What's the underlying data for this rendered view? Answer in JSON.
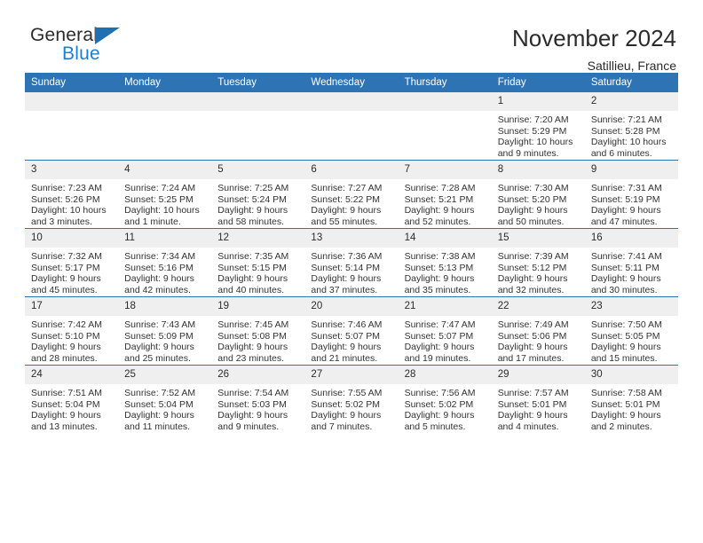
{
  "brand": {
    "name_part1": "General",
    "name_part2": "Blue",
    "triangle_color": "#1f6fb2",
    "blue_text_color": "#1b7fd4"
  },
  "header": {
    "month_title": "November 2024",
    "location": "Satillieu, France",
    "accent_color": "#2e74b5",
    "daynum_band_color": "#efefef"
  },
  "calendar": {
    "weekday_headers": [
      "Sunday",
      "Monday",
      "Tuesday",
      "Wednesday",
      "Thursday",
      "Friday",
      "Saturday"
    ],
    "labels": {
      "sunrise_prefix": "Sunrise:",
      "sunset_prefix": "Sunset:",
      "daylight_prefix": "Daylight:"
    },
    "weeks": [
      [
        {
          "day": "",
          "blank": true
        },
        {
          "day": "",
          "blank": true
        },
        {
          "day": "",
          "blank": true
        },
        {
          "day": "",
          "blank": true
        },
        {
          "day": "",
          "blank": true
        },
        {
          "day": "1",
          "sunrise": "Sunrise: 7:20 AM",
          "sunset": "Sunset: 5:29 PM",
          "daylight": "Daylight: 10 hours and 9 minutes."
        },
        {
          "day": "2",
          "sunrise": "Sunrise: 7:21 AM",
          "sunset": "Sunset: 5:28 PM",
          "daylight": "Daylight: 10 hours and 6 minutes."
        }
      ],
      [
        {
          "day": "3",
          "sunrise": "Sunrise: 7:23 AM",
          "sunset": "Sunset: 5:26 PM",
          "daylight": "Daylight: 10 hours and 3 minutes."
        },
        {
          "day": "4",
          "sunrise": "Sunrise: 7:24 AM",
          "sunset": "Sunset: 5:25 PM",
          "daylight": "Daylight: 10 hours and 1 minute."
        },
        {
          "day": "5",
          "sunrise": "Sunrise: 7:25 AM",
          "sunset": "Sunset: 5:24 PM",
          "daylight": "Daylight: 9 hours and 58 minutes."
        },
        {
          "day": "6",
          "sunrise": "Sunrise: 7:27 AM",
          "sunset": "Sunset: 5:22 PM",
          "daylight": "Daylight: 9 hours and 55 minutes."
        },
        {
          "day": "7",
          "sunrise": "Sunrise: 7:28 AM",
          "sunset": "Sunset: 5:21 PM",
          "daylight": "Daylight: 9 hours and 52 minutes."
        },
        {
          "day": "8",
          "sunrise": "Sunrise: 7:30 AM",
          "sunset": "Sunset: 5:20 PM",
          "daylight": "Daylight: 9 hours and 50 minutes."
        },
        {
          "day": "9",
          "sunrise": "Sunrise: 7:31 AM",
          "sunset": "Sunset: 5:19 PM",
          "daylight": "Daylight: 9 hours and 47 minutes."
        }
      ],
      [
        {
          "day": "10",
          "sunrise": "Sunrise: 7:32 AM",
          "sunset": "Sunset: 5:17 PM",
          "daylight": "Daylight: 9 hours and 45 minutes."
        },
        {
          "day": "11",
          "sunrise": "Sunrise: 7:34 AM",
          "sunset": "Sunset: 5:16 PM",
          "daylight": "Daylight: 9 hours and 42 minutes."
        },
        {
          "day": "12",
          "sunrise": "Sunrise: 7:35 AM",
          "sunset": "Sunset: 5:15 PM",
          "daylight": "Daylight: 9 hours and 40 minutes."
        },
        {
          "day": "13",
          "sunrise": "Sunrise: 7:36 AM",
          "sunset": "Sunset: 5:14 PM",
          "daylight": "Daylight: 9 hours and 37 minutes."
        },
        {
          "day": "14",
          "sunrise": "Sunrise: 7:38 AM",
          "sunset": "Sunset: 5:13 PM",
          "daylight": "Daylight: 9 hours and 35 minutes."
        },
        {
          "day": "15",
          "sunrise": "Sunrise: 7:39 AM",
          "sunset": "Sunset: 5:12 PM",
          "daylight": "Daylight: 9 hours and 32 minutes."
        },
        {
          "day": "16",
          "sunrise": "Sunrise: 7:41 AM",
          "sunset": "Sunset: 5:11 PM",
          "daylight": "Daylight: 9 hours and 30 minutes."
        }
      ],
      [
        {
          "day": "17",
          "sunrise": "Sunrise: 7:42 AM",
          "sunset": "Sunset: 5:10 PM",
          "daylight": "Daylight: 9 hours and 28 minutes."
        },
        {
          "day": "18",
          "sunrise": "Sunrise: 7:43 AM",
          "sunset": "Sunset: 5:09 PM",
          "daylight": "Daylight: 9 hours and 25 minutes."
        },
        {
          "day": "19",
          "sunrise": "Sunrise: 7:45 AM",
          "sunset": "Sunset: 5:08 PM",
          "daylight": "Daylight: 9 hours and 23 minutes."
        },
        {
          "day": "20",
          "sunrise": "Sunrise: 7:46 AM",
          "sunset": "Sunset: 5:07 PM",
          "daylight": "Daylight: 9 hours and 21 minutes."
        },
        {
          "day": "21",
          "sunrise": "Sunrise: 7:47 AM",
          "sunset": "Sunset: 5:07 PM",
          "daylight": "Daylight: 9 hours and 19 minutes."
        },
        {
          "day": "22",
          "sunrise": "Sunrise: 7:49 AM",
          "sunset": "Sunset: 5:06 PM",
          "daylight": "Daylight: 9 hours and 17 minutes."
        },
        {
          "day": "23",
          "sunrise": "Sunrise: 7:50 AM",
          "sunset": "Sunset: 5:05 PM",
          "daylight": "Daylight: 9 hours and 15 minutes."
        }
      ],
      [
        {
          "day": "24",
          "sunrise": "Sunrise: 7:51 AM",
          "sunset": "Sunset: 5:04 PM",
          "daylight": "Daylight: 9 hours and 13 minutes."
        },
        {
          "day": "25",
          "sunrise": "Sunrise: 7:52 AM",
          "sunset": "Sunset: 5:04 PM",
          "daylight": "Daylight: 9 hours and 11 minutes."
        },
        {
          "day": "26",
          "sunrise": "Sunrise: 7:54 AM",
          "sunset": "Sunset: 5:03 PM",
          "daylight": "Daylight: 9 hours and 9 minutes."
        },
        {
          "day": "27",
          "sunrise": "Sunrise: 7:55 AM",
          "sunset": "Sunset: 5:02 PM",
          "daylight": "Daylight: 9 hours and 7 minutes."
        },
        {
          "day": "28",
          "sunrise": "Sunrise: 7:56 AM",
          "sunset": "Sunset: 5:02 PM",
          "daylight": "Daylight: 9 hours and 5 minutes."
        },
        {
          "day": "29",
          "sunrise": "Sunrise: 7:57 AM",
          "sunset": "Sunset: 5:01 PM",
          "daylight": "Daylight: 9 hours and 4 minutes."
        },
        {
          "day": "30",
          "sunrise": "Sunrise: 7:58 AM",
          "sunset": "Sunset: 5:01 PM",
          "daylight": "Daylight: 9 hours and 2 minutes."
        }
      ]
    ]
  }
}
